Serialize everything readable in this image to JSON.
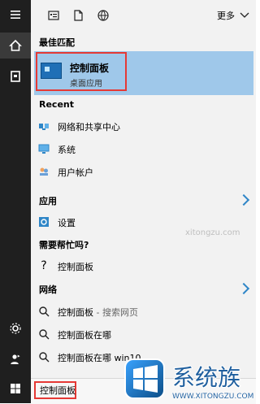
{
  "topbar": {
    "more_label": "更多"
  },
  "sections": {
    "best_match": "最佳匹配",
    "recent": "Recent",
    "apps": "应用",
    "help": "需要帮忙吗?",
    "network": "网络"
  },
  "best": {
    "title": "控制面板",
    "subtitle": "桌面应用"
  },
  "recent_items": [
    {
      "label": "网络和共享中心",
      "icon": "network-sharing-icon"
    },
    {
      "label": "系统",
      "icon": "system-icon"
    },
    {
      "label": "用户帐户",
      "icon": "user-accounts-icon"
    }
  ],
  "apps_items": [
    {
      "label": "设置",
      "icon": "settings-gear-icon"
    }
  ],
  "help_items": [
    {
      "label": "控制面板",
      "icon": "question-icon"
    }
  ],
  "network_items": [
    {
      "label": "控制面板",
      "secondary": "- 搜索网页",
      "icon": "search-icon"
    },
    {
      "label": "控制面板在哪",
      "icon": "search-icon"
    },
    {
      "label": "控制面板在哪 win10",
      "icon": "search-icon"
    }
  ],
  "search": {
    "value": "控制面板",
    "placeholder": ""
  },
  "logo": {
    "text": "系统族",
    "url_text": "WWW.XITONGZU.COM"
  },
  "watermark": "xitongzu.com",
  "colors": {
    "rail": "#1f1f1f",
    "panel": "#f2f2f2",
    "selected": "#9fc8ea",
    "highlight": "#e53935",
    "accent": "#2f86c7"
  }
}
